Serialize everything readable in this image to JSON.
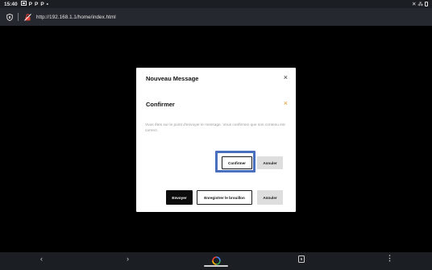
{
  "status_bar": {
    "time": "15:40",
    "notification_icons": [
      "image-icon",
      "p-icon",
      "p-icon",
      "p-icon",
      "dot-icon"
    ],
    "p_glyph": "P",
    "dot_glyph": "•",
    "right_icons": [
      "mute-icon",
      "wifi-icon",
      "battery-icon"
    ],
    "mute_glyph": "✕",
    "wifi_glyph": "⁂"
  },
  "browser": {
    "url": "http://192.168.1.1/home/index.html",
    "icons": [
      "shield-icon",
      "insecure-lock-icon"
    ]
  },
  "modal": {
    "title": "Nouveau Message",
    "close_glyph": "×",
    "confirm": {
      "title": "Confirmer",
      "close_glyph": "×",
      "text": "Vous êtes sur le point d'envoyer le message. Vous confirmez que son contenu est correct.",
      "confirm_label": "Confirmer",
      "cancel_label": "Annuler"
    },
    "footer": {
      "send_label": "Envoyer",
      "draft_label": "Enregistrer le brouillon",
      "cancel_label": "Annuler"
    }
  },
  "nav_bar": {
    "back_glyph": "‹",
    "forward_glyph": "›",
    "tab_count": "5",
    "menu_glyph": "⋮"
  },
  "colors": {
    "accent_orange": "#e6962a",
    "focus_blue": "#4a6fbf",
    "insecure_red": "#e0463a"
  }
}
